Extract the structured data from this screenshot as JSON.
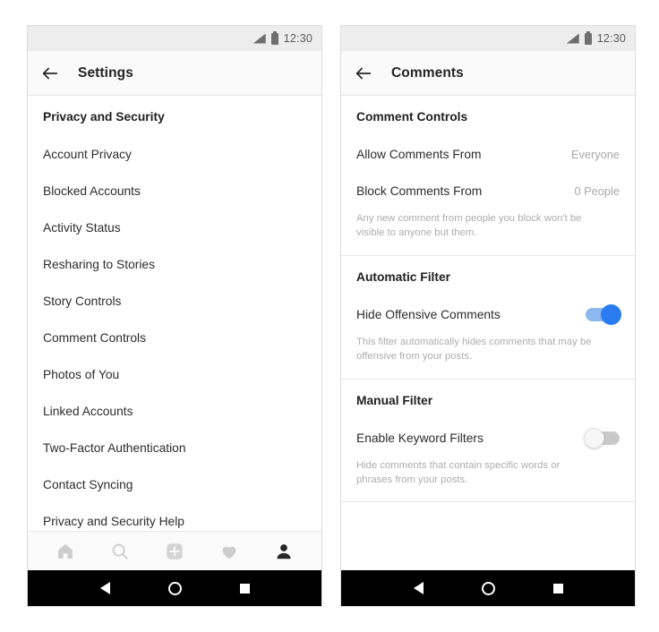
{
  "status_bar": {
    "time": "12:30",
    "signal_icon": "signal-triangle-icon",
    "battery_icon": "battery-icon"
  },
  "phones": {
    "left": {
      "app_bar": {
        "back_icon": "back-arrow-icon",
        "title": "Settings"
      },
      "section_header": "Privacy and Security",
      "items": [
        "Account Privacy",
        "Blocked Accounts",
        "Activity Status",
        "Resharing to Stories",
        "Story Controls",
        "Comment Controls",
        "Photos of You",
        "Linked Accounts",
        "Two-Factor Authentication",
        "Contact Syncing",
        "Privacy and Security Help"
      ],
      "tab_bar": [
        {
          "name": "home-icon",
          "active": false
        },
        {
          "name": "search-icon",
          "active": false
        },
        {
          "name": "add-post-icon",
          "active": false
        },
        {
          "name": "heart-icon",
          "active": false
        },
        {
          "name": "profile-icon",
          "active": true
        }
      ]
    },
    "right": {
      "app_bar": {
        "back_icon": "back-arrow-icon",
        "title": "Comments"
      },
      "groups": [
        {
          "header": "Comment Controls",
          "rows": [
            {
              "label": "Allow Comments From",
              "value": "Everyone"
            },
            {
              "label": "Block Comments From",
              "value": "0 People"
            }
          ],
          "helper": "Any new comment from people you block won't be visible to anyone but them."
        },
        {
          "header": "Automatic Filter",
          "rows": [
            {
              "label": "Hide Offensive Comments",
              "toggle": "on"
            }
          ],
          "helper": "This filter automatically hides comments that may be offensive from your posts."
        },
        {
          "header": "Manual Filter",
          "rows": [
            {
              "label": "Enable Keyword Filters",
              "toggle": "off"
            }
          ],
          "helper": "Hide comments that contain specific words or phrases from your posts."
        }
      ]
    }
  },
  "android_nav": {
    "back": "nav-back-icon",
    "home": "nav-home-icon",
    "recents": "nav-recents-icon"
  },
  "colors": {
    "toggle_on_track": "#8cb8f0",
    "toggle_on_knob": "#2b7cf0",
    "toggle_off_track": "#c9c9c9",
    "status_bar_bg": "#ededed",
    "app_bar_bg": "#fafafa"
  }
}
